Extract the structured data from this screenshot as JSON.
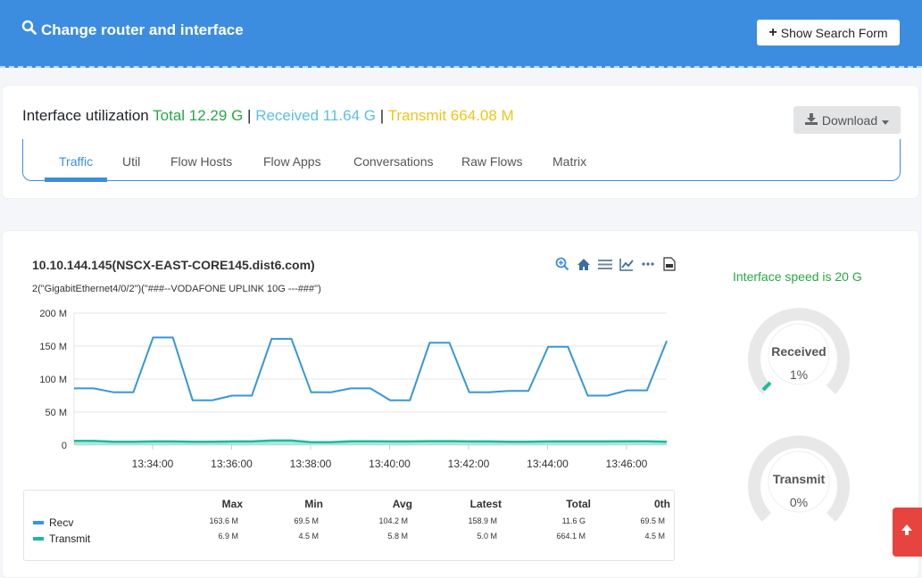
{
  "header": {
    "title": "Change router and interface",
    "search_button": "Show Search Form"
  },
  "utilization": {
    "label": "Interface utilization",
    "total": "Total 12.29 G",
    "sep1": "|",
    "received": "Received 11.64 G",
    "sep2": "|",
    "transmit": "Transmit 664.08 M",
    "download_label": "Download"
  },
  "tabs": [
    {
      "label": "Traffic",
      "active": true
    },
    {
      "label": "Util"
    },
    {
      "label": "Flow Hosts"
    },
    {
      "label": "Flow Apps"
    },
    {
      "label": "Conversations"
    },
    {
      "label": "Raw Flows"
    },
    {
      "label": "Matrix"
    }
  ],
  "chart": {
    "title": "10.10.144.145(NSCX-EAST-CORE145.dist6.com)",
    "subtitle": "2(\"GigabitEthernet4/0/2\")(\"###--VODAFONE UPLINK 10G ---###\")",
    "toolbar_icons": [
      "zoom-in-icon",
      "home-icon",
      "menu-icon",
      "line-chart-icon",
      "more-icon",
      "pdf-icon"
    ]
  },
  "chart_data": {
    "type": "line",
    "y_ticks": [
      "200 M",
      "150 M",
      "100 M",
      "50 M",
      "0"
    ],
    "x_ticks": [
      "13:34:00",
      "13:36:00",
      "13:38:00",
      "13:40:00",
      "13:42:00",
      "13:44:00",
      "13:46:00"
    ],
    "ylim": [
      0,
      200
    ],
    "y_unit": "M",
    "series": [
      {
        "name": "Recv",
        "color": "#3498db",
        "values": [
          86,
          86,
          80,
          80,
          163,
          163,
          68,
          68,
          75,
          75,
          161,
          161,
          80,
          80,
          86,
          86,
          68,
          68,
          155,
          155,
          80,
          80,
          82,
          82,
          149,
          149,
          75,
          75,
          83,
          83,
          158
        ]
      },
      {
        "name": "Transmit",
        "color": "#1abc9c",
        "values": [
          6.5,
          6.5,
          5.0,
          5.0,
          5.5,
          5.5,
          5.0,
          5.0,
          5.5,
          5.5,
          6.9,
          6.9,
          4.5,
          4.5,
          5.8,
          5.8,
          5.5,
          5.5,
          6.0,
          6.0,
          5.5,
          5.5,
          5.0,
          5.0,
          5.5,
          5.5,
          5.5,
          5.5,
          5.8,
          5.8,
          5.0
        ]
      }
    ],
    "stats": {
      "headers": [
        "Max",
        "Min",
        "Avg",
        "Latest",
        "Total",
        "0th"
      ],
      "rows": [
        {
          "name": "Recv",
          "color": "#3498db",
          "values": [
            "163.6 M",
            "69.5 M",
            "104.2 M",
            "158.9 M",
            "11.6 G",
            "69.5 M"
          ]
        },
        {
          "name": "Transmit",
          "color": "#1abc9c",
          "values": [
            "6.9 M",
            "4.5 M",
            "5.8 M",
            "5.0 M",
            "664.1 M",
            "4.5 M"
          ]
        }
      ]
    }
  },
  "gauges": {
    "speed_label": "Interface speed is 20 G",
    "received": {
      "label": "Received",
      "value": "1%",
      "percent": 1
    },
    "transmit": {
      "label": "Transmit",
      "value": "0%",
      "percent": 0
    }
  },
  "colors": {
    "primary": "#3c8de0",
    "recv": "#3498db",
    "transmit": "#1abc9c",
    "scroll_top": "#e8443f"
  }
}
